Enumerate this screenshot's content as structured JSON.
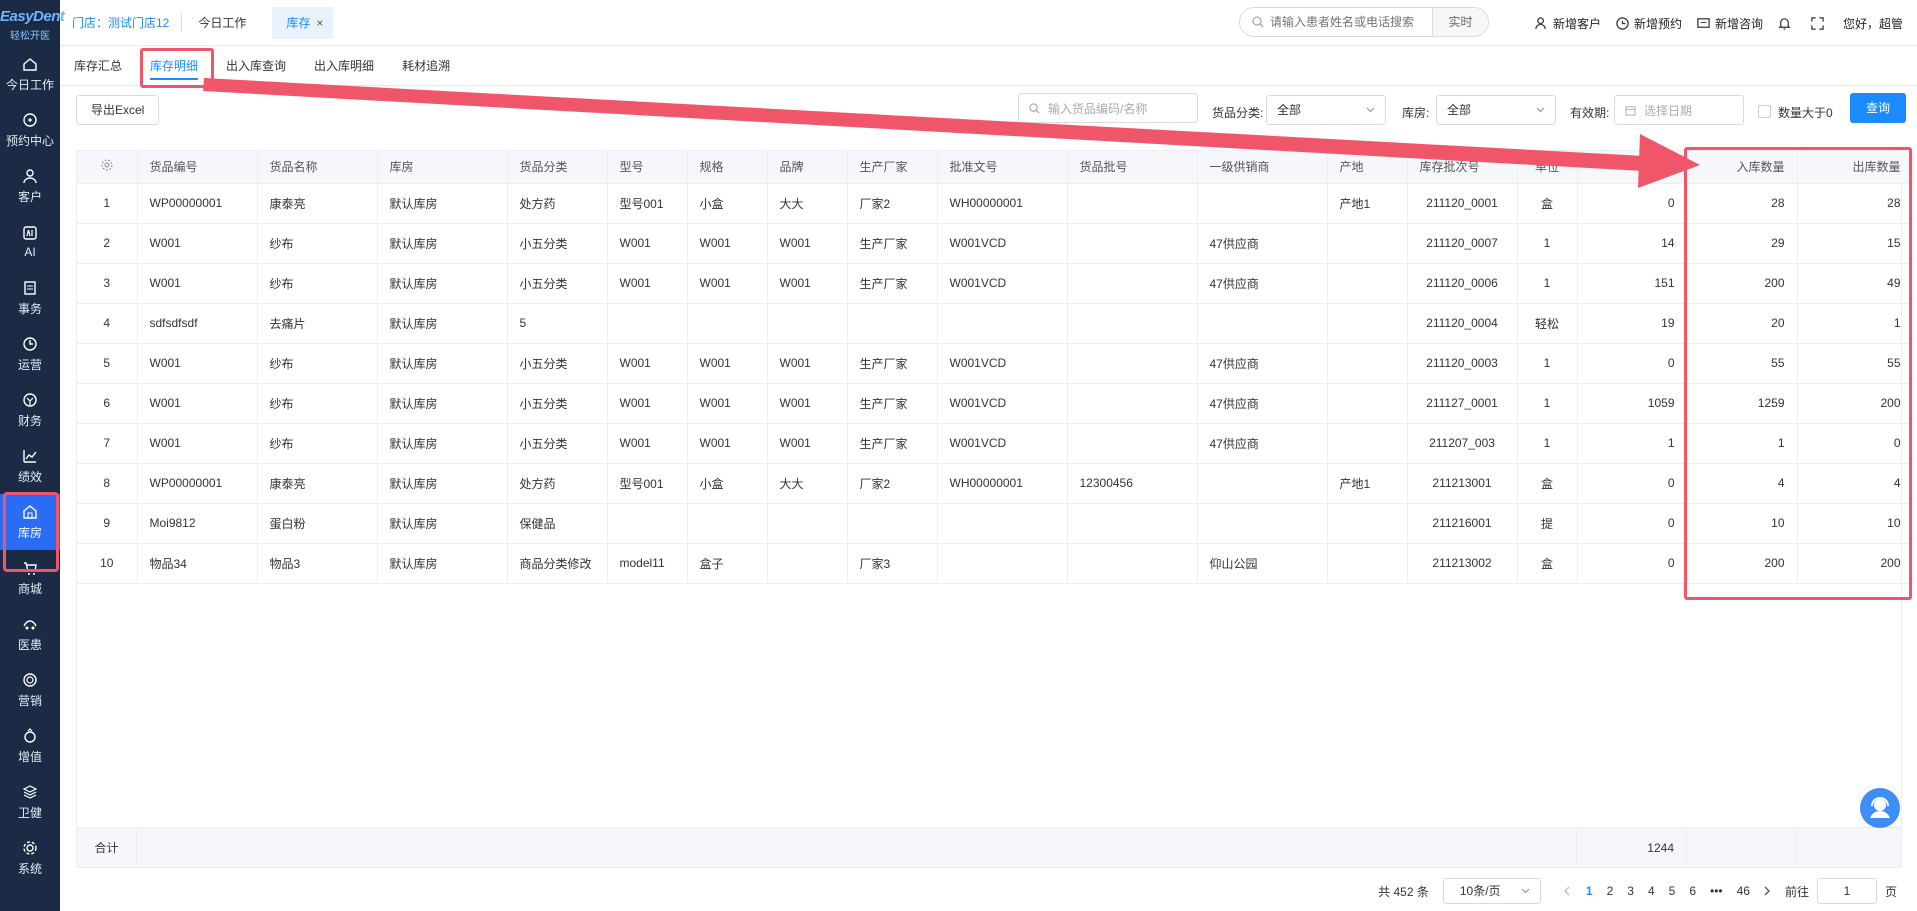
{
  "brand": {
    "name": "EasyDent",
    "tagline": "轻松开医"
  },
  "sidebar": {
    "items": [
      {
        "label": "今日工作",
        "icon": "home-icon"
      },
      {
        "label": "预约中心",
        "icon": "calendar-icon"
      },
      {
        "label": "客户",
        "icon": "user-icon"
      },
      {
        "label": "AI",
        "icon": "ai-icon"
      },
      {
        "label": "事务",
        "icon": "task-icon"
      },
      {
        "label": "运营",
        "icon": "clock-icon"
      },
      {
        "label": "财务",
        "icon": "finance-icon"
      },
      {
        "label": "绩效",
        "icon": "chart-icon"
      },
      {
        "label": "库房",
        "icon": "warehouse-icon",
        "active": true
      },
      {
        "label": "商城",
        "icon": "cart-icon"
      },
      {
        "label": "医患",
        "icon": "doctor-icon"
      },
      {
        "label": "营销",
        "icon": "marketing-icon"
      },
      {
        "label": "增值",
        "icon": "value-icon"
      },
      {
        "label": "卫健",
        "icon": "health-icon"
      },
      {
        "label": "系统",
        "icon": "settings-icon"
      }
    ]
  },
  "topbar": {
    "store": "门店：测试门店12",
    "tabs": [
      {
        "label": "今日工作"
      },
      {
        "label": "库存",
        "closable": "×"
      }
    ],
    "search": {
      "placeholder": "请输入患者姓名或电话搜索",
      "realtime": "实时"
    },
    "actions": {
      "new_customer": "新增客户",
      "new_appointment": "新增预约",
      "new_consult": "新增咨询"
    },
    "greeting": "您好，超管"
  },
  "subtabs": [
    "库存汇总",
    "库存明细",
    "出入库查询",
    "出入库明细",
    "耗材追溯"
  ],
  "filters": {
    "export": "导出Excel",
    "goods_placeholder": "输入货品编码/名称",
    "category_label": "货品分类:",
    "category_value": "全部",
    "warehouse_label": "库房:",
    "warehouse_value": "全部",
    "expiry_label": "有效期:",
    "expiry_placeholder": "选择日期",
    "qty_gt0": "数量大于0",
    "query": "查询"
  },
  "table": {
    "headers": [
      "货品编号",
      "货品名称",
      "库房",
      "货品分类",
      "型号",
      "规格",
      "品牌",
      "生产厂家",
      "批准文号",
      "货品批号",
      "一级供销商",
      "产地",
      "库存批次号",
      "单位",
      "",
      "入库数量",
      "出库数量"
    ],
    "rows": [
      [
        "1",
        "WP00000001",
        "康泰亮",
        "默认库房",
        "处方药",
        "型号001",
        "小盒",
        "大大",
        "厂家2",
        "WH00000001",
        "",
        "",
        "产地1",
        "211120_0001",
        "盒",
        "0",
        "28",
        "28"
      ],
      [
        "2",
        "W001",
        "纱布",
        "默认库房",
        "小五分类",
        "W001",
        "W001",
        "W001",
        "生产厂家",
        "W001VCD",
        "",
        "47供应商",
        "",
        "211120_0007",
        "1",
        "14",
        "29",
        "15"
      ],
      [
        "3",
        "W001",
        "纱布",
        "默认库房",
        "小五分类",
        "W001",
        "W001",
        "W001",
        "生产厂家",
        "W001VCD",
        "",
        "47供应商",
        "",
        "211120_0006",
        "1",
        "151",
        "200",
        "49"
      ],
      [
        "4",
        "sdfsdfsdf",
        "去痛片",
        "默认库房",
        "5",
        "",
        "",
        "",
        "",
        "",
        "",
        "",
        "",
        "211120_0004",
        "轻松",
        "19",
        "20",
        "1"
      ],
      [
        "5",
        "W001",
        "纱布",
        "默认库房",
        "小五分类",
        "W001",
        "W001",
        "W001",
        "生产厂家",
        "W001VCD",
        "",
        "47供应商",
        "",
        "211120_0003",
        "1",
        "0",
        "55",
        "55"
      ],
      [
        "6",
        "W001",
        "纱布",
        "默认库房",
        "小五分类",
        "W001",
        "W001",
        "W001",
        "生产厂家",
        "W001VCD",
        "",
        "47供应商",
        "",
        "211127_0001",
        "1",
        "1059",
        "1259",
        "200"
      ],
      [
        "7",
        "W001",
        "纱布",
        "默认库房",
        "小五分类",
        "W001",
        "W001",
        "W001",
        "生产厂家",
        "W001VCD",
        "",
        "47供应商",
        "",
        "211207_003",
        "1",
        "1",
        "1",
        "0"
      ],
      [
        "8",
        "WP00000001",
        "康泰亮",
        "默认库房",
        "处方药",
        "型号001",
        "小盒",
        "大大",
        "厂家2",
        "WH00000001",
        "12300456",
        "",
        "产地1",
        "211213001",
        "盒",
        "0",
        "4",
        "4"
      ],
      [
        "9",
        "Moi9812",
        "蛋白粉",
        "默认库房",
        "保健品",
        "",
        "",
        "",
        "",
        "",
        "",
        "",
        "",
        "211216001",
        "提",
        "0",
        "10",
        "10"
      ],
      [
        "10",
        "物品34",
        "物品3",
        "默认库房",
        "商品分类修改",
        "model11",
        "盒子",
        "",
        "厂家3",
        "",
        "",
        "仰山公园",
        "",
        "211213002",
        "盒",
        "0",
        "200",
        "200"
      ]
    ],
    "footer": {
      "label": "合计",
      "total": "1244"
    }
  },
  "pagination": {
    "total": "共 452 条",
    "page_size": "10条/页",
    "pages": [
      "1",
      "2",
      "3",
      "4",
      "5",
      "6"
    ],
    "ellipsis": "•••",
    "last": "46",
    "goto_label": "前往",
    "goto_value": "1",
    "page_suffix": "页"
  },
  "colors": {
    "accent": "#1a8cff",
    "sidebar": "#1b2b45",
    "highlight": "#f0566a"
  }
}
